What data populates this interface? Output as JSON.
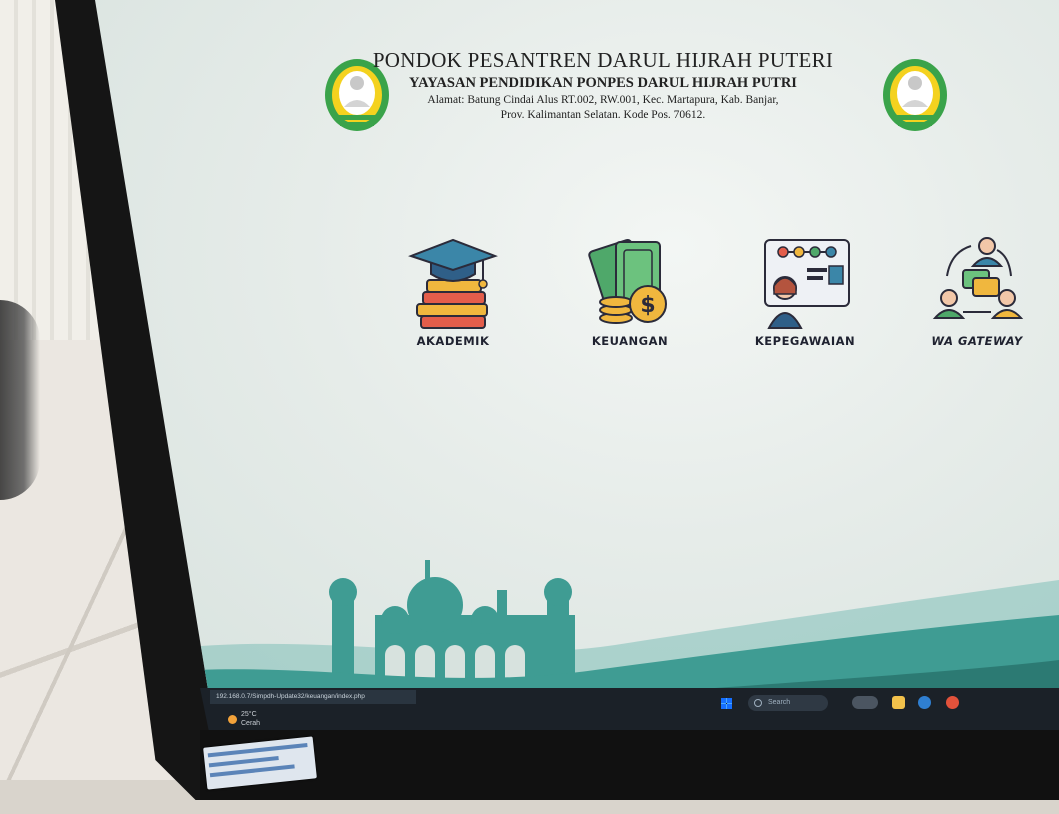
{
  "header": {
    "title": "PONDOK PESANTREN DARUL HIJRAH PUTERI",
    "subtitle": "YAYASAN PENDIDIKAN PONPES DARUL HIJRAH PUTRI",
    "address_line1": "Alamat: Batung Cindai Alus RT.002, RW.001, Kec. Martapura, Kab. Banjar,",
    "address_line2": "Prov. Kalimantan Selatan. Kode Pos. 70612."
  },
  "menu": [
    {
      "label": "AKADEMIK",
      "icon": "graduation-books-icon"
    },
    {
      "label": "KEUANGAN",
      "icon": "money-coins-icon"
    },
    {
      "label": "KEPEGAWAIAN",
      "icon": "employee-profile-icon"
    },
    {
      "label": "WA GATEWAY",
      "icon": "chat-network-icon"
    }
  ],
  "statusbar": {
    "url": "192.168.0.7/Simpdh-Update32/keuangan/index.php"
  },
  "taskbar": {
    "weather_temp": "25°C",
    "weather_desc": "Cerah",
    "search_placeholder": "Search"
  },
  "colors": {
    "teal": "#3f9c93",
    "teal_dark": "#2c7a73",
    "logo_green": "#3aa34a",
    "logo_yellow": "#f4d21f"
  }
}
